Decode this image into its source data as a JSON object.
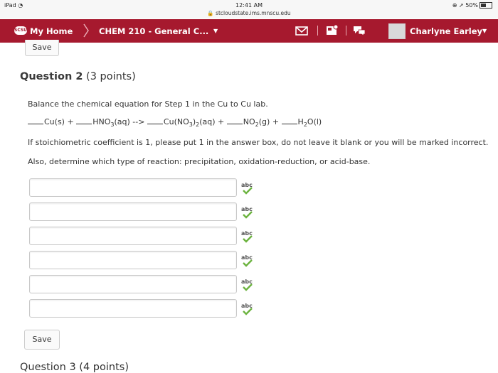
{
  "status_bar": {
    "device": "iPad",
    "wifi_icon": "wifi-icon",
    "time": "12:41 AM",
    "url": "stcloudstate.ims.mnscu.edu",
    "battery": "50%"
  },
  "nav": {
    "logo_text": "SCSU",
    "home": "My Home",
    "course": "CHEM 210 - General C...",
    "user": "Charlyne Earley",
    "icons": [
      "mail-icon",
      "news-icon",
      "chat-icon"
    ],
    "colors": {
      "navbar": "#a6192e"
    }
  },
  "top_save": "Save",
  "question": {
    "number_label": "Question 2",
    "points": "(3 points)",
    "prompt": "Balance the chemical equation for Step 1 in the Cu to Cu lab.",
    "equation": {
      "t1": "Cu(s) + ",
      "t2": "HNO",
      "t2_sub": "3",
      "t3": "(aq) --> ",
      "t4": "Cu(NO",
      "t4_sub1": "3",
      "t4_mid": ")",
      "t4_sub2": "2",
      "t5": "(aq) + ",
      "t6": "NO",
      "t6_sub": "2",
      "t7": "(g) + ",
      "t8": "H",
      "t8_sub": "2",
      "t9": "O(l)"
    },
    "instruction1": "If stoichiometric coefficient is 1, please put 1 in the answer box, do not leave it blank or you will be marked incorrect.",
    "instruction2": "Also, determine which type of reaction: precipitation, oxidation-reduction, or acid-base.",
    "answers": [
      "",
      "",
      "",
      "",
      "",
      ""
    ],
    "save": "Save"
  },
  "next_question": "Question 3 (4 points)"
}
